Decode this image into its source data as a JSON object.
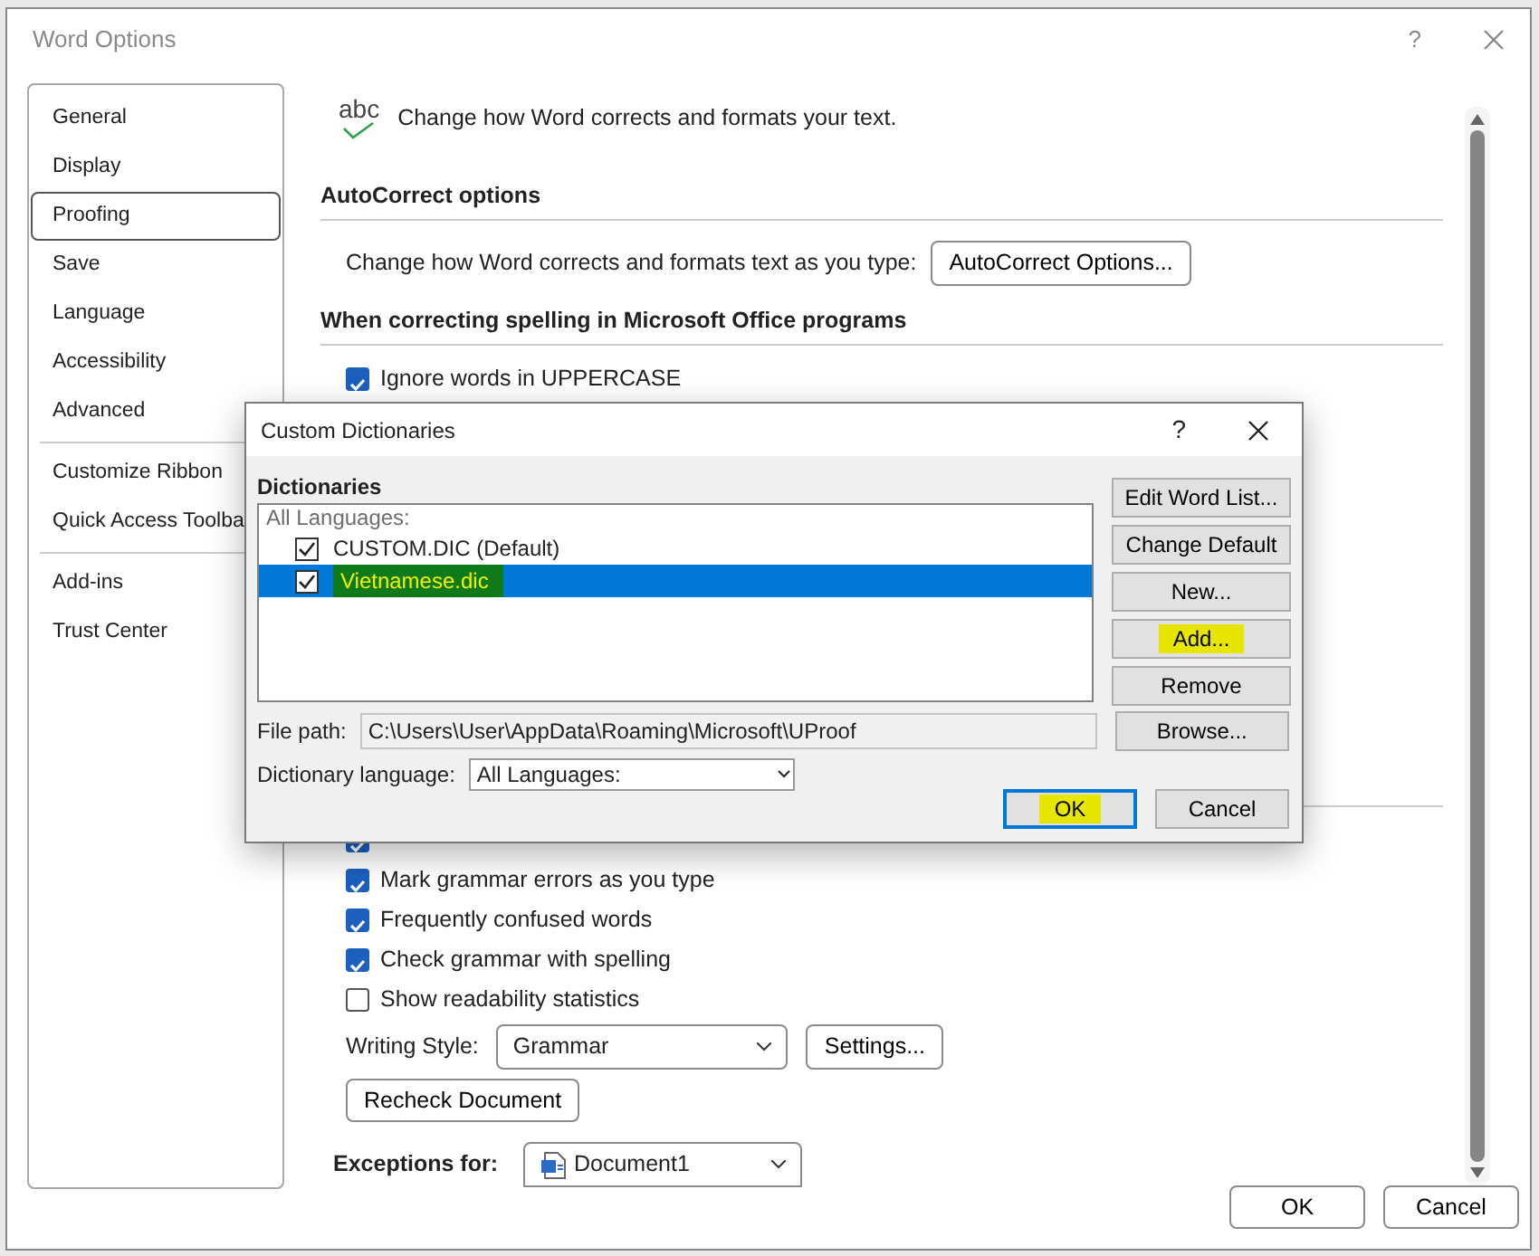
{
  "window": {
    "title": "Word Options",
    "help": "?"
  },
  "sidebar": {
    "groups": [
      [
        {
          "label": "General",
          "selected": false
        },
        {
          "label": "Display",
          "selected": false
        },
        {
          "label": "Proofing",
          "selected": true
        },
        {
          "label": "Save",
          "selected": false
        },
        {
          "label": "Language",
          "selected": false
        },
        {
          "label": "Accessibility",
          "selected": false
        },
        {
          "label": "Advanced",
          "selected": false
        }
      ],
      [
        {
          "label": "Customize Ribbon",
          "selected": false
        },
        {
          "label": "Quick Access Toolba",
          "selected": false
        }
      ],
      [
        {
          "label": "Add-ins",
          "selected": false
        },
        {
          "label": "Trust Center",
          "selected": false
        }
      ]
    ]
  },
  "header": {
    "icon_text": "abc",
    "text": "Change how Word corrects and formats your text."
  },
  "autocorrect": {
    "heading": "AutoCorrect options",
    "description": "Change how Word corrects and formats text as you type:",
    "button": "AutoCorrect Options..."
  },
  "spelling": {
    "heading": "When correcting spelling in Microsoft Office programs",
    "options": [
      {
        "label": "Ignore words in UPPERCASE",
        "checked": true
      }
    ]
  },
  "grammar": {
    "options": [
      {
        "checked": true
      },
      {
        "label": "Mark grammar errors as you type",
        "checked": true
      },
      {
        "label": "Frequently confused words",
        "checked": true
      },
      {
        "label": "Check grammar with spelling",
        "checked": true
      },
      {
        "label": "Show readability statistics",
        "checked": false
      }
    ],
    "writing_style": {
      "label": "Writing Style:",
      "value": "Grammar",
      "button": "Settings..."
    },
    "recheck_button": "Recheck Document"
  },
  "exceptions": {
    "label": "Exceptions for:",
    "value": "Document1"
  },
  "footer_buttons": [
    "OK",
    "Cancel"
  ],
  "dialog": {
    "title": "Custom Dictionaries",
    "help": "?",
    "section_label": "Dictionaries",
    "group_label": "All Languages:",
    "items": [
      {
        "label": "CUSTOM.DIC (Default)",
        "checked": true,
        "selected": false,
        "highlighted": false
      },
      {
        "label": "Vietnamese.dic",
        "checked": true,
        "selected": true,
        "highlighted": true
      }
    ],
    "buttons": [
      {
        "label": "Edit Word List...",
        "highlighted": false
      },
      {
        "label": "Change Default",
        "highlighted": false
      },
      {
        "label": "New...",
        "highlighted": false
      },
      {
        "label": "Add...",
        "highlighted": true
      },
      {
        "label": "Remove",
        "highlighted": false
      }
    ],
    "file_path": {
      "label": "File path:",
      "value": "C:\\Users\\User\\AppData\\Roaming\\Microsoft\\UProof",
      "button": "Browse..."
    },
    "language": {
      "label": "Dictionary language:",
      "value": "All Languages:"
    },
    "footer_buttons": [
      {
        "label": "OK",
        "default": true,
        "highlighted": true
      },
      {
        "label": "Cancel",
        "default": false,
        "highlighted": false
      }
    ]
  }
}
